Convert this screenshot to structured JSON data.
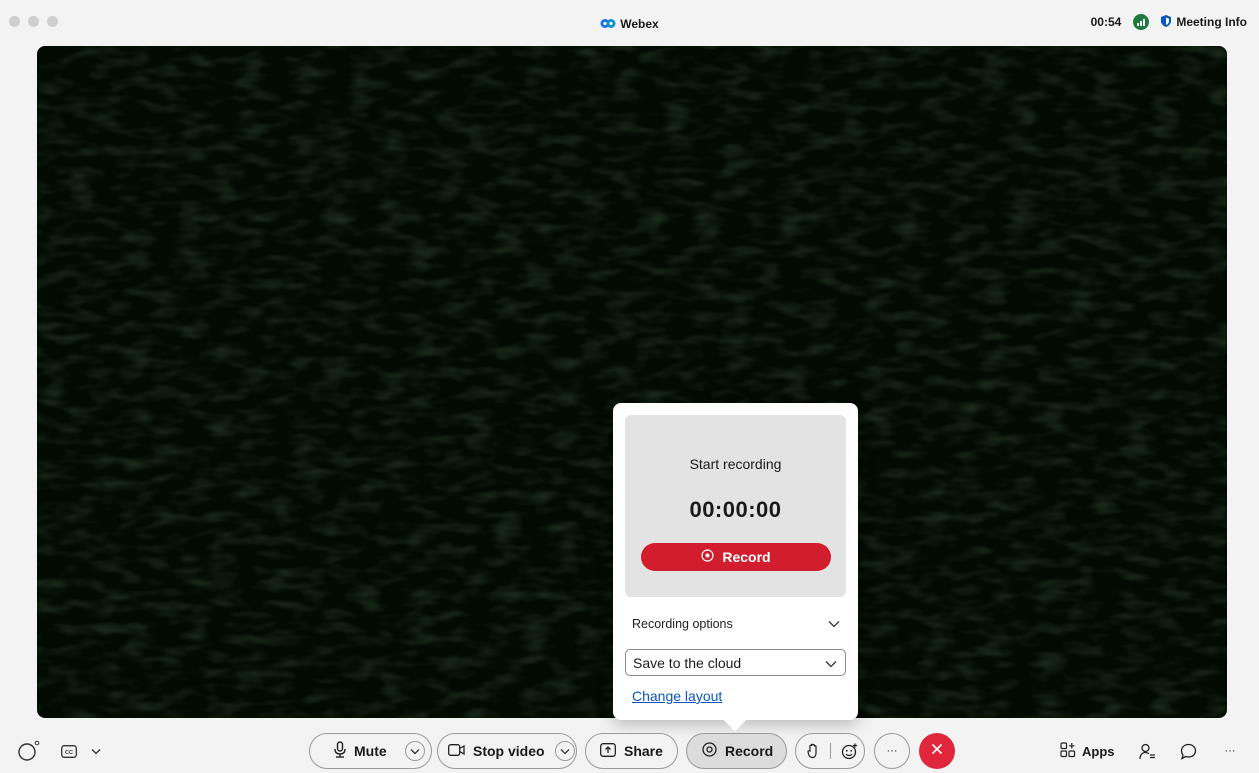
{
  "app": {
    "title": "Webex"
  },
  "header": {
    "clock": "00:54",
    "meeting_info_label": "Meeting Info"
  },
  "recording_popover": {
    "heading": "Start recording",
    "timer": "00:00:00",
    "record_button_label": "Record",
    "options_label": "Recording options",
    "save_location": "Save to the cloud",
    "change_layout_link": "Change layout"
  },
  "toolbar": {
    "mute_label": "Mute",
    "stop_video_label": "Stop video",
    "share_label": "Share",
    "record_label": "Record",
    "more_label": "···",
    "apps_label": "Apps",
    "overflow_label": "···"
  },
  "colors": {
    "end_call": "#e0263a",
    "record_button": "#d21d2f",
    "link": "#0a57c2",
    "signal": "#1e7a3c"
  },
  "icons": [
    "webex-logo-icon",
    "signal-icon",
    "shield-icon",
    "status-ring-icon",
    "captions-icon",
    "chevron-down-icon",
    "microphone-icon",
    "video-camera-icon",
    "share-screen-icon",
    "record-icon",
    "raise-hand-icon",
    "reactions-icon",
    "end-call-icon",
    "apps-icon",
    "participants-icon",
    "chat-icon"
  ]
}
